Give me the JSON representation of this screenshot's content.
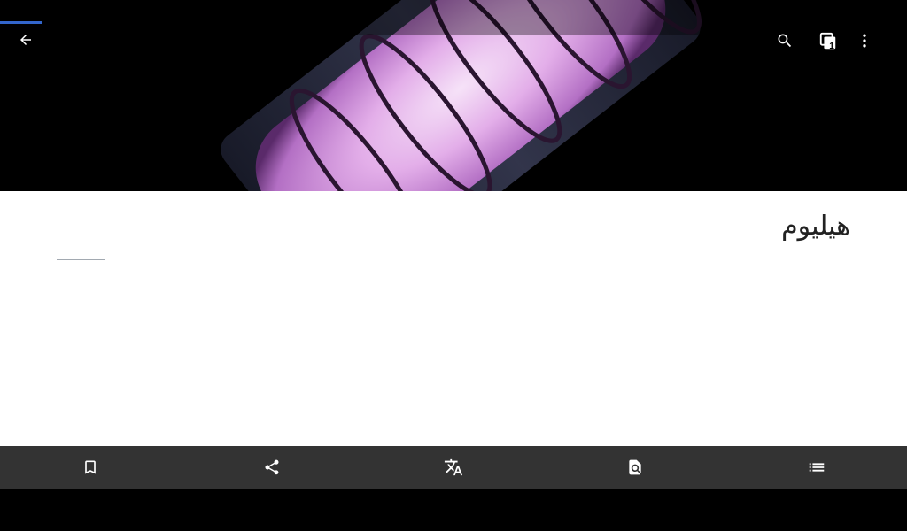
{
  "article": {
    "title": "هيليوم"
  },
  "toolbar": {
    "tab_count": "1",
    "icons": [
      "back-arrow-icon",
      "search-icon",
      "tabs-icon",
      "overflow-menu-icon"
    ]
  },
  "bottom_bar": {
    "icons": [
      "bookmark-icon",
      "share-icon",
      "translate-icon",
      "find-in-page-icon",
      "contents-icon"
    ]
  },
  "colors": {
    "progress": "#3366cc",
    "bottom_bar": "#333333",
    "tube_glow": "#e7b6ec"
  }
}
